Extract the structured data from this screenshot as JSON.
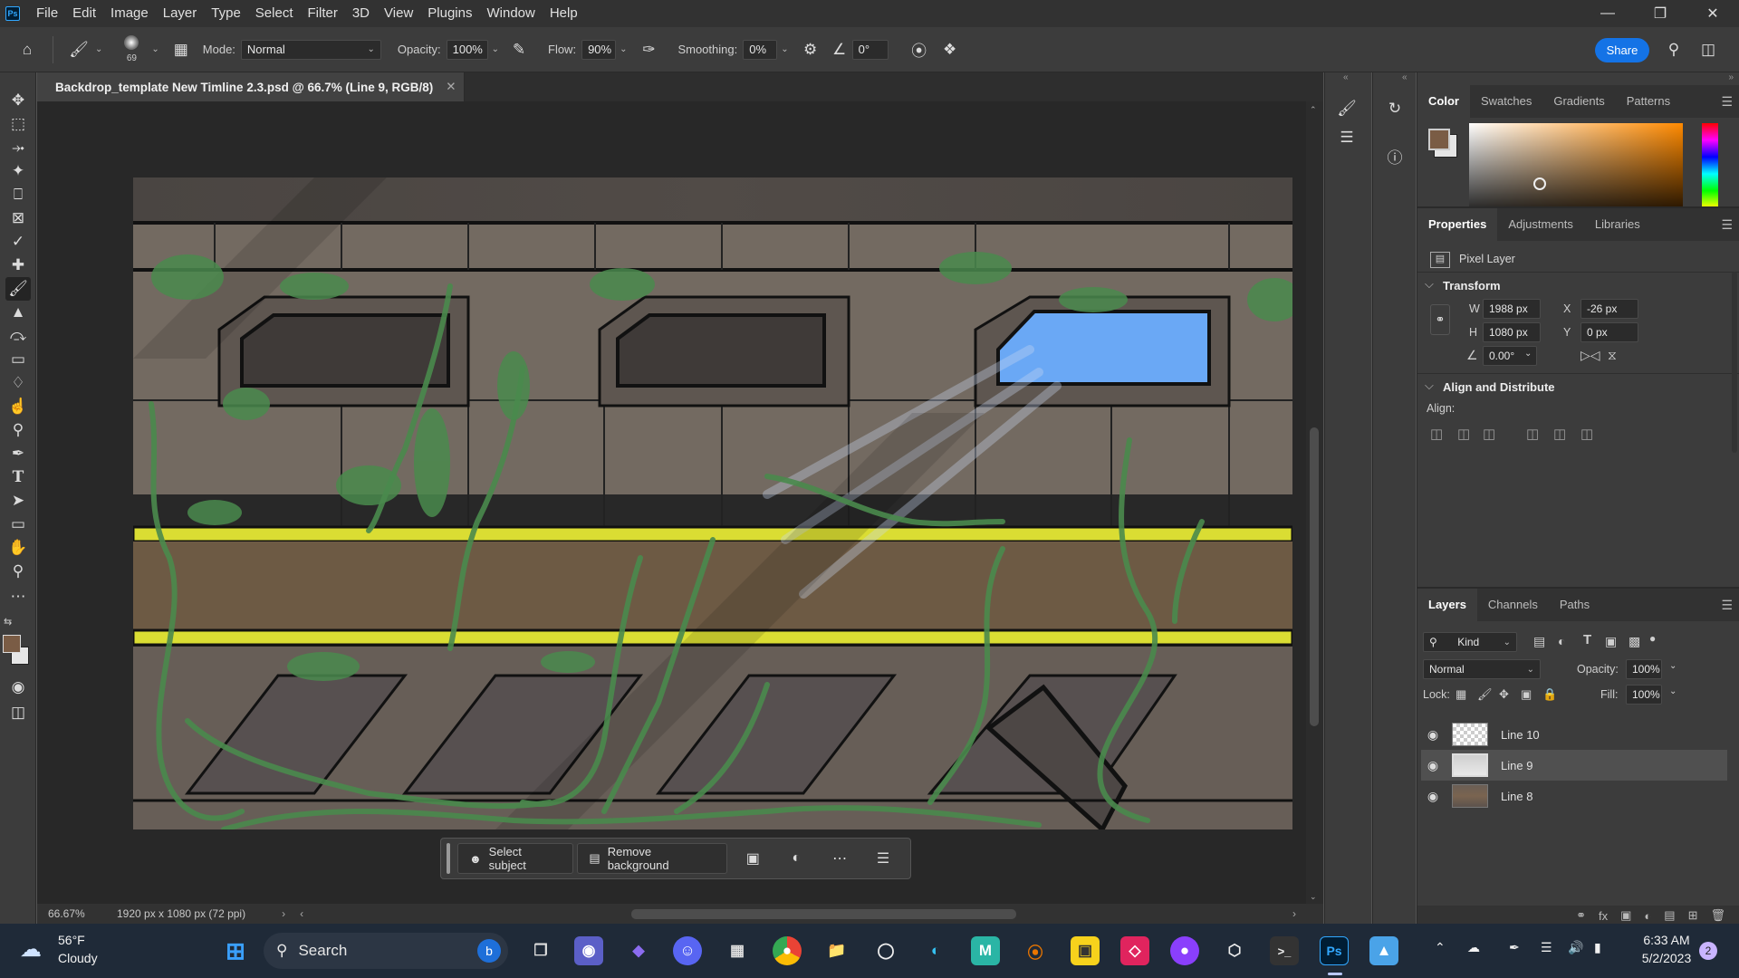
{
  "app": {
    "logo": "Ps"
  },
  "menu": [
    "File",
    "Edit",
    "Image",
    "Layer",
    "Type",
    "Select",
    "Filter",
    "3D",
    "View",
    "Plugins",
    "Window",
    "Help"
  ],
  "options": {
    "brush_size": "69",
    "mode_label": "Mode:",
    "mode_value": "Normal",
    "opacity_label": "Opacity:",
    "opacity_value": "100%",
    "flow_label": "Flow:",
    "flow_value": "90%",
    "smoothing_label": "Smoothing:",
    "smoothing_value": "0%",
    "angle_value": "0°",
    "share_label": "Share"
  },
  "document": {
    "tab_title": "Backdrop_template New Timline 2.3.psd @ 66.7% (Line 9, RGB/8)",
    "zoom": "66.67%",
    "info": "1920 px x 1080 px (72 ppi)"
  },
  "context_bar": {
    "select_subject": "Select subject",
    "remove_background": "Remove background"
  },
  "color_panel": {
    "tabs": [
      "Color",
      "Swatches",
      "Gradients",
      "Patterns"
    ],
    "foreground": "#7a5c45",
    "background": "#e6e6e6",
    "hue_color": "#ff8a00"
  },
  "properties_panel": {
    "tabs": [
      "Properties",
      "Adjustments",
      "Libraries"
    ],
    "layer_type": "Pixel Layer",
    "transform_title": "Transform",
    "w_label": "W",
    "w_value": "1988 px",
    "h_label": "H",
    "h_value": "1080 px",
    "x_label": "X",
    "x_value": "-26 px",
    "y_label": "Y",
    "y_value": "0 px",
    "angle_value": "0.00°",
    "align_title": "Align and Distribute",
    "align_label": "Align:"
  },
  "layers_panel": {
    "tabs": [
      "Layers",
      "Channels",
      "Paths"
    ],
    "kind_label": "Kind",
    "blend_mode": "Normal",
    "opacity_label": "Opacity:",
    "opacity_value": "100%",
    "lock_label": "Lock:",
    "fill_label": "Fill:",
    "fill_value": "100%",
    "layers": [
      {
        "name": "Line 10",
        "selected": false
      },
      {
        "name": "Line 9",
        "selected": true
      },
      {
        "name": "Line 8",
        "selected": false
      }
    ]
  },
  "taskbar": {
    "weather_temp": "56°F",
    "weather_desc": "Cloudy",
    "search_label": "Search",
    "time": "6:33 AM",
    "date": "5/2/2023",
    "notification_count": "2"
  }
}
